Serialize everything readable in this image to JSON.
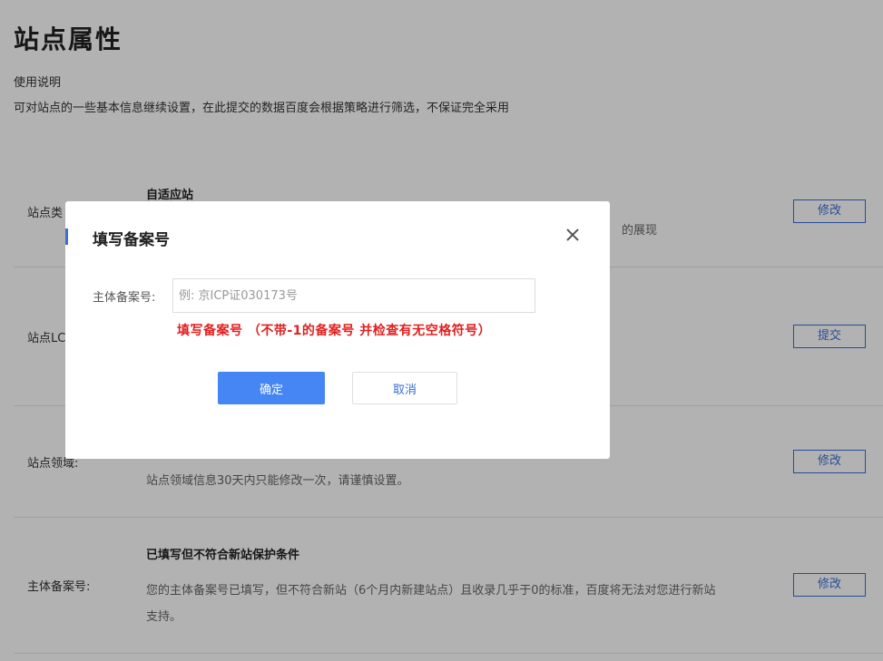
{
  "page": {
    "title": "站点属性",
    "usage_title": "使用说明",
    "usage_desc": "可对站点的一些基本信息继续设置，在此提交的数据百度会根据策略进行筛选，不保证完全采用"
  },
  "rows": [
    {
      "label": "站点类",
      "heading": "自适应站",
      "text": "的展现",
      "button": "修改"
    },
    {
      "label": "站点LC",
      "button": "提交"
    },
    {
      "label": "站点领域:",
      "text": "站点领域信息30天内只能修改一次，请谨慎设置。",
      "button": "修改"
    },
    {
      "label": "主体备案号:",
      "heading": "已填写但不符合新站保护条件",
      "text_line1": "您的主体备案号已填写，但不符合新站（6个月内新建站点）且收录几乎于0的标准，百度将无法对您进行新站",
      "text_line2": "支持。",
      "button": "修改"
    }
  ],
  "modal": {
    "title": "填写备案号",
    "close_icon": "close-icon",
    "field_label": "主体备案号:",
    "field_value": "",
    "field_placeholder": "例: 京ICP证030173号",
    "hint": "填写备案号 （不带-1的备案号 并检查有无空格符号）",
    "ok_label": "确定",
    "cancel_label": "取消"
  },
  "colors": {
    "accent": "#3a6fd8",
    "primary_button": "#4586f4",
    "hint_red": "#e02020",
    "overlay": "rgba(0,0,0,0.30)"
  }
}
